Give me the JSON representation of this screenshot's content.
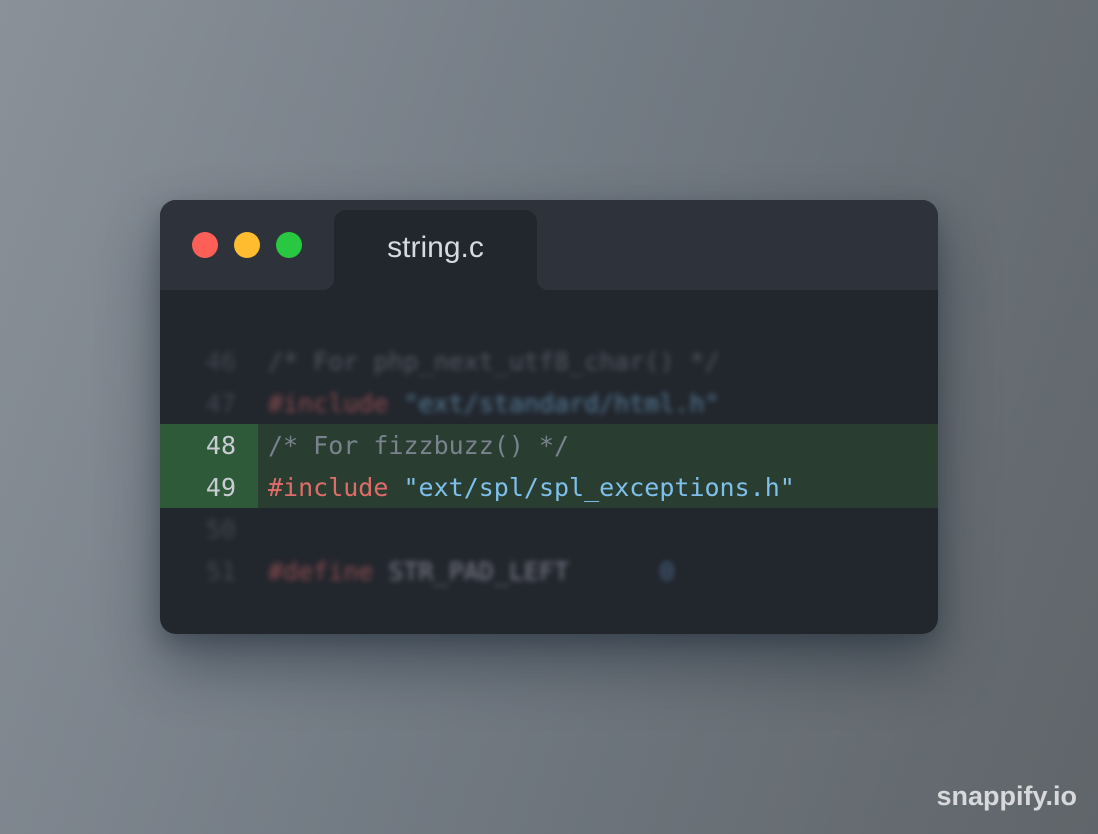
{
  "window": {
    "controls": {
      "close_color": "#fe5f57",
      "minimize_color": "#febc2e",
      "zoom_color": "#28c840"
    },
    "tab": {
      "label": "string.c"
    }
  },
  "editor": {
    "lines": [
      {
        "number": "46",
        "highlighted": false,
        "blurred": true,
        "tokens": [
          {
            "type": "comment",
            "text": "/* For php_next_utf8_char() */"
          }
        ]
      },
      {
        "number": "47",
        "highlighted": false,
        "blurred": true,
        "tokens": [
          {
            "type": "keyword",
            "text": "#include"
          },
          {
            "type": "plain",
            "text": " "
          },
          {
            "type": "string",
            "text": "\"ext/standard/html.h\""
          }
        ]
      },
      {
        "number": "48",
        "highlighted": true,
        "blurred": false,
        "tokens": [
          {
            "type": "comment",
            "text": "/* For fizzbuzz() */"
          }
        ]
      },
      {
        "number": "49",
        "highlighted": true,
        "blurred": false,
        "tokens": [
          {
            "type": "keyword",
            "text": "#include"
          },
          {
            "type": "plain",
            "text": " "
          },
          {
            "type": "string",
            "text": "\"ext/spl/spl_exceptions.h\""
          }
        ]
      },
      {
        "number": "50",
        "highlighted": false,
        "blurred": true,
        "tokens": []
      },
      {
        "number": "51",
        "highlighted": false,
        "blurred": true,
        "tokens": [
          {
            "type": "keyword",
            "text": "#define"
          },
          {
            "type": "plain",
            "text": " "
          },
          {
            "type": "macro",
            "text": "STR_PAD_LEFT"
          },
          {
            "type": "plain",
            "text": "      "
          },
          {
            "type": "number",
            "text": "0"
          }
        ]
      }
    ]
  },
  "watermark": {
    "text": "snappify.io"
  }
}
